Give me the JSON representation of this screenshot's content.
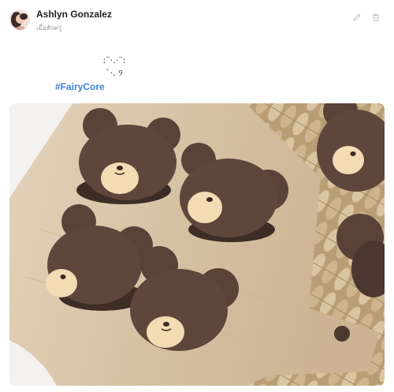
{
  "post": {
    "author": {
      "name": "Ashlyn Gonzalez",
      "timestamp": "เมื่อสักครู่"
    },
    "body_lines": [
      ":¨·.·¨:",
      "`·. ୨"
    ],
    "hashtag": "#FairyCore",
    "actions": [
      {
        "icon": "pencil-icon",
        "color": "#c7c7c7"
      },
      {
        "icon": "trash-icon",
        "color": "#c7c7c7"
      }
    ]
  },
  "colors": {
    "hashtag": "#3b82d6",
    "cookie": "#5a4239",
    "cookie_face": "#f3dcb3",
    "board": "#d8c4a8",
    "basket": "#c9b28d"
  }
}
